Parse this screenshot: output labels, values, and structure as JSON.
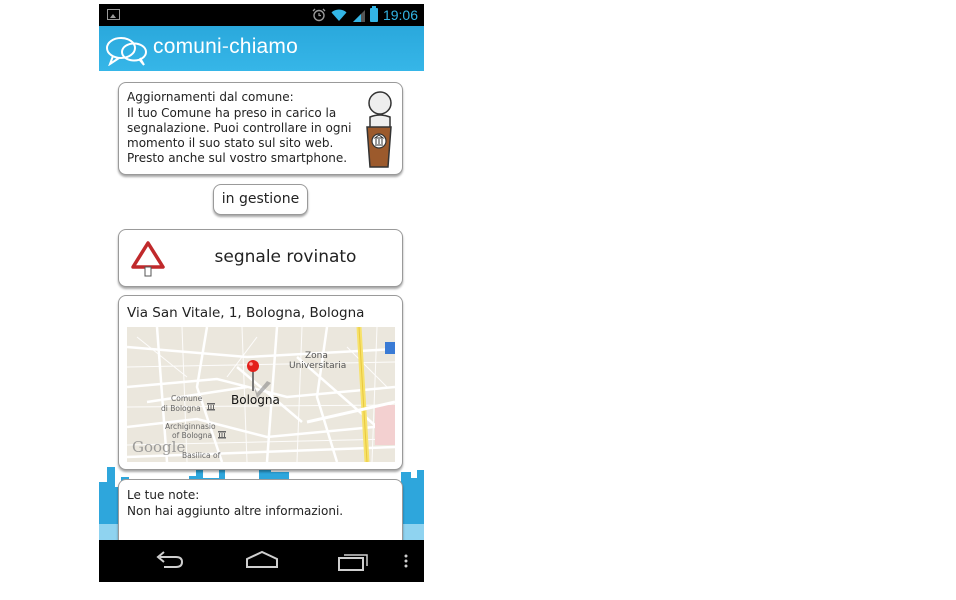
{
  "status_bar": {
    "time": "19:06"
  },
  "app": {
    "title_part1": "comuni",
    "title_sep": "-",
    "title_part2": "chiamo"
  },
  "update": {
    "title": "Aggiornamenti dal comune:",
    "text": "Il tuo Comune ha preso in carico la segnalazione. Puoi controllare in ogni momento il suo stato sul sito web. Presto anche sul vostro smartphone."
  },
  "status_badge": "in gestione",
  "category": {
    "label": "segnale rovinato",
    "icon": "warning-triangle-icon"
  },
  "location": {
    "address": "Via San Vitale, 1, Bologna, Bologna",
    "map_labels": {
      "city": "Bologna",
      "zona": "Zona",
      "universitaria": "Universitaria",
      "comune": "Comune",
      "di_bologna": "di Bologna",
      "archiginnasio": "Archiginnasio",
      "of_bologna": "of Bologna",
      "basilica": "Basilica of",
      "google": "Google"
    }
  },
  "notes": {
    "title": "Le tue note:",
    "text": "Non hai aggiunto altre informazioni."
  },
  "colors": {
    "accent": "#33b5e5",
    "header": "#2aa8dc",
    "warning": "#c0292b"
  }
}
